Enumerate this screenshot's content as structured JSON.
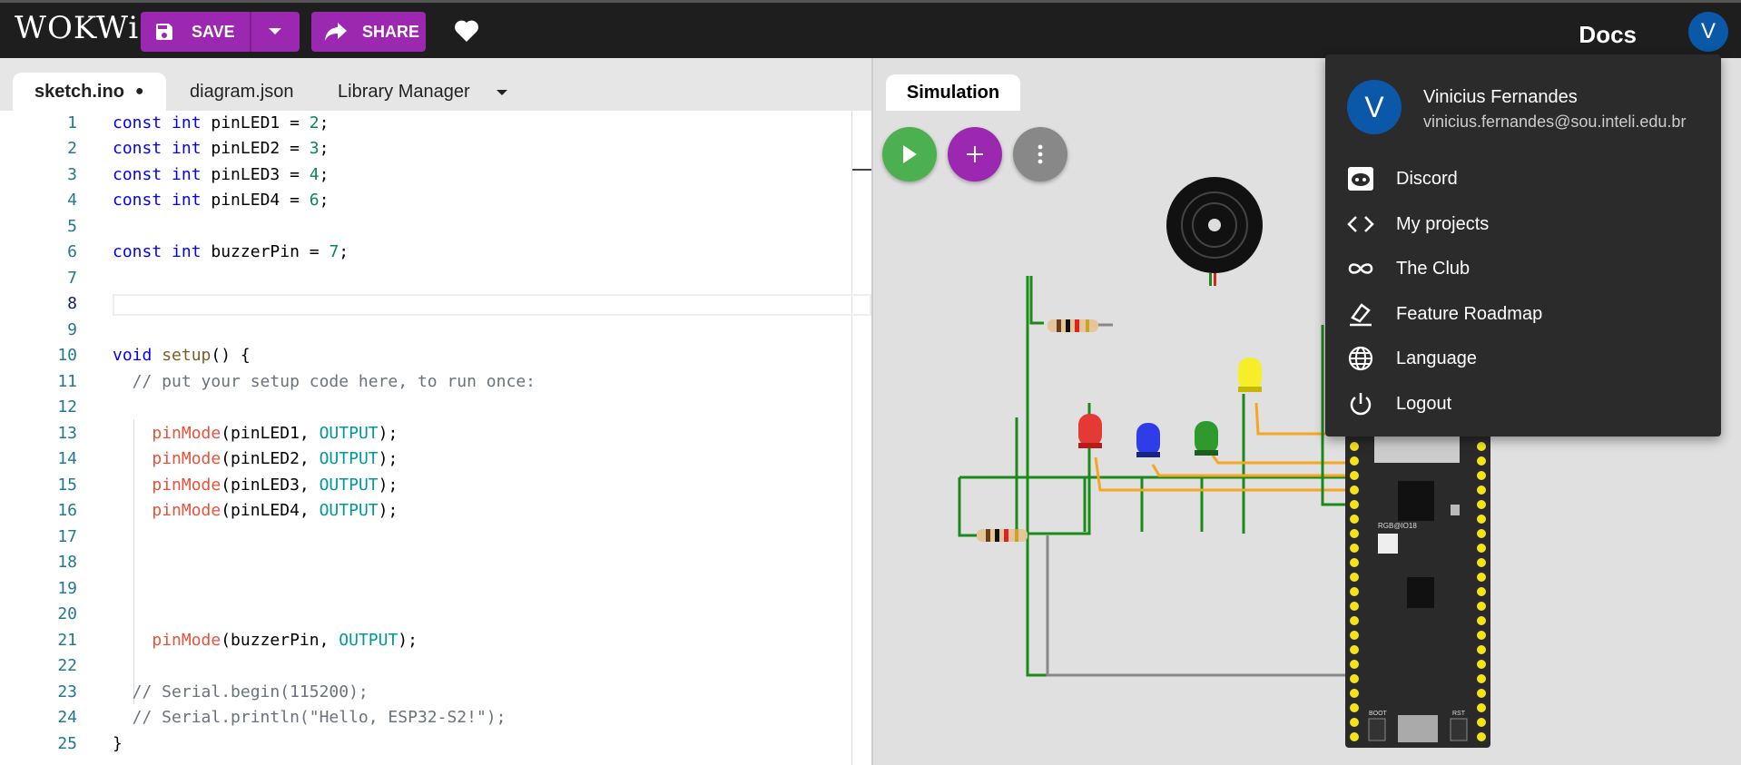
{
  "header": {
    "logo": "WOKWi",
    "save_label": "SAVE",
    "share_label": "SHARE",
    "docs_label": "Docs",
    "avatar_initial": "V"
  },
  "editor": {
    "tabs": [
      {
        "label": "sketch.ino",
        "dot": "●"
      },
      {
        "label": "diagram.json"
      },
      {
        "label": "Library Manager"
      }
    ],
    "line_numbers": [
      "1",
      "2",
      "3",
      "4",
      "5",
      "6",
      "7",
      "8",
      "9",
      "10",
      "11",
      "12",
      "13",
      "14",
      "15",
      "16",
      "17",
      "18",
      "19",
      "20",
      "21",
      "22",
      "23",
      "24",
      "25"
    ],
    "lines": [
      "const int pinLED1 = 2;",
      "const int pinLED2 = 3;",
      "const int pinLED3 = 4;",
      "const int pinLED4 = 6;",
      "",
      "const int buzzerPin = 7;",
      "",
      "",
      "",
      "void setup() {",
      "  // put your setup code here, to run once:",
      "",
      "    pinMode(pinLED1, OUTPUT);",
      "    pinMode(pinLED2, OUTPUT);",
      "    pinMode(pinLED3, OUTPUT);",
      "    pinMode(pinLED4, OUTPUT);",
      "",
      "",
      "",
      "",
      "    pinMode(buzzerPin, OUTPUT);",
      "",
      "  // Serial.begin(115200);",
      "  // Serial.println(\"Hello, ESP32-S2!\");",
      "}"
    ]
  },
  "simulation": {
    "tab_label": "Simulation",
    "board_labels": {
      "rgb": "RGB@IO18",
      "boot": "BOOT",
      "rst": "RST"
    }
  },
  "user_menu": {
    "avatar_initial": "V",
    "name": "Vinicius Fernandes",
    "email": "vinicius.fernandes@sou.inteli.edu.br",
    "items": [
      {
        "label": "Discord",
        "icon": "discord-icon"
      },
      {
        "label": "My projects",
        "icon": "code-icon"
      },
      {
        "label": "The Club",
        "icon": "infinity-icon"
      },
      {
        "label": "Feature Roadmap",
        "icon": "roadmap-icon"
      },
      {
        "label": "Language",
        "icon": "globe-icon"
      },
      {
        "label": "Logout",
        "icon": "power-icon"
      }
    ]
  },
  "colors": {
    "accent": "#9c27b0",
    "run": "#4caf50",
    "avatar": "#0b58a8",
    "wire_green": "#1a8a1a",
    "wire_orange": "#f5a623"
  }
}
